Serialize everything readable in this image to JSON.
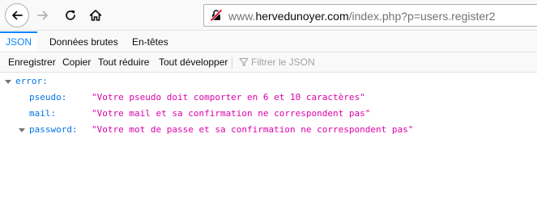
{
  "navbar": {
    "back_icon": "arrow-left-icon",
    "forward_icon": "arrow-right-icon",
    "reload_icon": "reload-icon",
    "home_icon": "home-icon",
    "url_prefix": "www.",
    "url_domain": "hervedunoyer.com",
    "url_path": "/index.php?p=users.register2"
  },
  "tabs": {
    "json": "JSON",
    "raw": "Données brutes",
    "headers": "En-têtes"
  },
  "toolbar": {
    "save": "Enregistrer",
    "copy": "Copier",
    "collapse": "Tout réduire",
    "expand": "Tout développer",
    "filter_placeholder": "Filtrer le JSON"
  },
  "json": {
    "root_key": "error:",
    "entries": [
      {
        "key": "pseudo:",
        "value": "\"Votre pseudo doit comporter en 6 et 10 caractères\""
      },
      {
        "key": "mail:",
        "value": "\"Votre mail et sa confirmation ne correspondent pas\""
      },
      {
        "key": "password:",
        "value": "\"Votre mot de passe et sa confirmation ne correspondent pas\""
      }
    ]
  },
  "colors": {
    "accent": "#0a84ff",
    "json_key": "#0074e8",
    "json_string": "#dd00a9",
    "insecure_lock": "#d70022"
  }
}
